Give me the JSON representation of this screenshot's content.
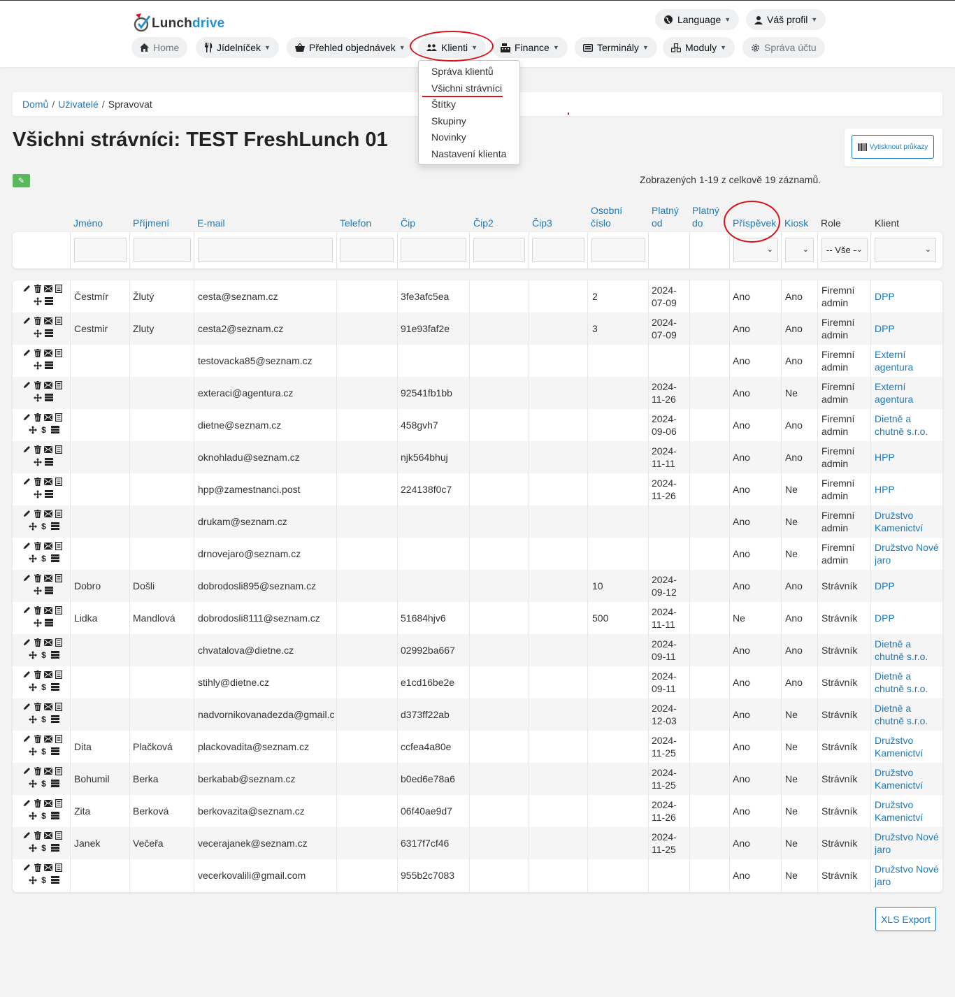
{
  "brand": {
    "name_part1": "Lunch",
    "name_part2": "drive"
  },
  "top_right": {
    "language": "Language",
    "profile": "Váš profil"
  },
  "nav": {
    "home": "Home",
    "menu": "Jídelníček",
    "orders": "Přehled objednávek",
    "clients": "Klienti",
    "finance": "Finance",
    "terminals": "Terminály",
    "modules": "Moduly",
    "account": "Správa účtu"
  },
  "clients_menu": [
    "Správa klientů",
    "Všichni strávníci",
    "Štítky",
    "Skupiny",
    "Novinky",
    "Nastavení klienta"
  ],
  "breadcrumb": {
    "home": "Domů",
    "users": "Uživatelé",
    "current": "Spravovat"
  },
  "page_title": "Všichni strávníci: TEST FreshLunch 01",
  "print_button": "Vytisknout průkazy",
  "summary": "Zobrazených 1-19 z celkově 19 záznamů.",
  "columns": {
    "first": "Jméno",
    "last": "Příjmení",
    "email": "E-mail",
    "phone": "Telefon",
    "chip": "Čip",
    "chip2": "Čip2",
    "chip3": "Čip3",
    "personal_no": "Osobní číslo",
    "valid_from": "Platný od",
    "valid_to": "Platný do",
    "contribution": "Příspěvek",
    "kiosk": "Kiosk",
    "role": "Role",
    "client": "Klient"
  },
  "filters": {
    "role_selected": "-- Vše --"
  },
  "rows": [
    {
      "first": "Čestmír",
      "last": "Žlutý",
      "email": "cesta@seznam.cz",
      "chip": "3fe3afc5ea",
      "pno": "2",
      "from": "2024-07-09",
      "contrib": "Ano",
      "kiosk": "Ano",
      "role": "Firemní admin",
      "client": "DPP",
      "dollar": false
    },
    {
      "first": "Cestmir",
      "last": "Zluty",
      "email": "cesta2@seznam.cz",
      "chip": "91e93faf2e",
      "pno": "3",
      "from": "2024-07-09",
      "contrib": "Ano",
      "kiosk": "Ano",
      "role": "Firemní admin",
      "client": "DPP",
      "dollar": false
    },
    {
      "first": "",
      "last": "",
      "email": "testovacka85@seznam.cz",
      "chip": "",
      "pno": "",
      "from": "",
      "contrib": "Ano",
      "kiosk": "Ano",
      "role": "Firemní admin",
      "client": "Externí agentura",
      "dollar": false
    },
    {
      "first": "",
      "last": "",
      "email": "exteraci@agentura.cz",
      "chip": "92541fb1bb",
      "pno": "",
      "from": "2024-11-26",
      "contrib": "Ano",
      "kiosk": "Ne",
      "role": "Firemní admin",
      "client": "Externí agentura",
      "dollar": false
    },
    {
      "first": "",
      "last": "",
      "email": "dietne@seznam.cz",
      "chip": "458gvh7",
      "pno": "",
      "from": "2024-09-06",
      "contrib": "Ano",
      "kiosk": "Ano",
      "role": "Firemní admin",
      "client": "Dietně a chutně s.r.o.",
      "dollar": true
    },
    {
      "first": "",
      "last": "",
      "email": "oknohladu@seznam.cz",
      "chip": "njk564bhuj",
      "pno": "",
      "from": "2024-11-11",
      "contrib": "Ano",
      "kiosk": "Ano",
      "role": "Firemní admin",
      "client": "HPP",
      "dollar": false
    },
    {
      "first": "",
      "last": "",
      "email": "hpp@zamestnanci.post",
      "chip": "224138f0c7",
      "pno": "",
      "from": "2024-11-26",
      "contrib": "Ano",
      "kiosk": "Ne",
      "role": "Firemní admin",
      "client": "HPP",
      "dollar": false
    },
    {
      "first": "",
      "last": "",
      "email": "drukam@seznam.cz",
      "chip": "",
      "pno": "",
      "from": "",
      "contrib": "Ano",
      "kiosk": "Ne",
      "role": "Firemní admin",
      "client": "Družstvo Kamenictví",
      "dollar": true
    },
    {
      "first": "",
      "last": "",
      "email": "drnovejaro@seznam.cz",
      "chip": "",
      "pno": "",
      "from": "",
      "contrib": "Ano",
      "kiosk": "Ne",
      "role": "Firemní admin",
      "client": "Družstvo Nové jaro",
      "dollar": true
    },
    {
      "first": "Dobro",
      "last": "Došli",
      "email": "dobrodosli895@seznam.cz",
      "chip": "",
      "pno": "10",
      "from": "2024-09-12",
      "contrib": "Ano",
      "kiosk": "Ano",
      "role": "Strávník",
      "client": "DPP",
      "dollar": false
    },
    {
      "first": "Lidka",
      "last": "Mandlová",
      "email": "dobrodosli8111@seznam.cz",
      "chip": "51684hjv6",
      "pno": "500",
      "from": "2024-11-11",
      "contrib": "Ne",
      "kiosk": "Ano",
      "role": "Strávník",
      "client": "DPP",
      "dollar": false
    },
    {
      "first": "",
      "last": "",
      "email": "chvatalova@dietne.cz",
      "chip": "02992ba667",
      "pno": "",
      "from": "2024-09-11",
      "contrib": "Ano",
      "kiosk": "Ano",
      "role": "Strávník",
      "client": "Dietně a chutně s.r.o.",
      "dollar": true
    },
    {
      "first": "",
      "last": "",
      "email": "stihly@dietne.cz",
      "chip": "e1cd16be2e",
      "pno": "",
      "from": "2024-09-11",
      "contrib": "Ano",
      "kiosk": "Ano",
      "role": "Strávník",
      "client": "Dietně a chutně s.r.o.",
      "dollar": true
    },
    {
      "first": "",
      "last": "",
      "email": "nadvornikovanadezda@gmail.com",
      "chip": "d373ff22ab",
      "pno": "",
      "from": "2024-12-03",
      "contrib": "Ano",
      "kiosk": "Ne",
      "role": "Strávník",
      "client": "Dietně a chutně s.r.o.",
      "dollar": true
    },
    {
      "first": "Dita",
      "last": "Plačková",
      "email": "plackovadita@seznam.cz",
      "chip": "ccfea4a80e",
      "pno": "",
      "from": "2024-11-25",
      "contrib": "Ano",
      "kiosk": "Ne",
      "role": "Strávník",
      "client": "Družstvo Kamenictví",
      "dollar": true
    },
    {
      "first": "Bohumil",
      "last": "Berka",
      "email": "berkabab@seznam.cz",
      "chip": "b0ed6e78a6",
      "pno": "",
      "from": "2024-11-25",
      "contrib": "Ano",
      "kiosk": "Ne",
      "role": "Strávník",
      "client": "Družstvo Kamenictví",
      "dollar": true
    },
    {
      "first": "Zita",
      "last": "Berková",
      "email": "berkovazita@seznam.cz",
      "chip": "06f40ae9d7",
      "pno": "",
      "from": "2024-11-26",
      "contrib": "Ano",
      "kiosk": "Ne",
      "role": "Strávník",
      "client": "Družstvo Kamenictví",
      "dollar": true
    },
    {
      "first": "Janek",
      "last": "Večeřa",
      "email": "vecerajanek@seznam.cz",
      "chip": "6317f7cf46",
      "pno": "",
      "from": "2024-11-25",
      "contrib": "Ano",
      "kiosk": "Ne",
      "role": "Strávník",
      "client": "Družstvo Nové jaro",
      "dollar": true
    },
    {
      "first": "",
      "last": "",
      "email": "vecerkovalili@gmail.com",
      "chip": "955b2c7083",
      "pno": "",
      "from": "",
      "contrib": "Ano",
      "kiosk": "Ne",
      "role": "Strávník",
      "client": "Družstvo Nové jaro",
      "dollar": true
    }
  ],
  "export_button": "XLS Export",
  "colors": {
    "link": "#1a7bbd",
    "highlight": "#d6141c",
    "edit_button": "#5cb85c"
  }
}
